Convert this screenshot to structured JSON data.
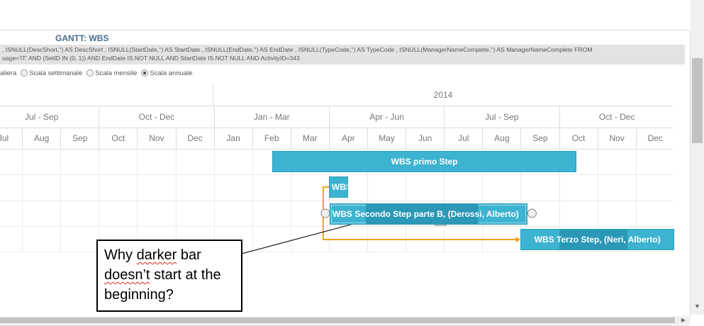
{
  "header": {
    "title": "GANTT: WBS",
    "sql_line1": ", ISNULL(DescShort,'') AS DescShort , ISNULL(StartDate,'') AS StartDate , ISNULL(EndDate,'') AS EndDate , ISNULL(TypeCode,'') AS TypeCode , ISNULL(ManagerNameComplete,'') AS ManagerNameComplete FROM",
    "sql_line2": "uage='IT' AND (SetID IN (0, 1)) AND EndDate IS NOT NULL AND StartDate IS NOT NULL AND ActivityID=343"
  },
  "scale_options": [
    {
      "label": "aliera",
      "selected": false,
      "show_radio": false
    },
    {
      "label": "Scala settimanale",
      "selected": false,
      "show_radio": true
    },
    {
      "label": "Scala mensile",
      "selected": false,
      "show_radio": true
    },
    {
      "label": "Scala annuale",
      "selected": true,
      "show_radio": true
    }
  ],
  "timeline": {
    "year_label": "2014",
    "quarters": [
      "Jul - Sep",
      "Oct - Dec",
      "Jan - Mar",
      "Apr - Jun",
      "Jul - Sep",
      "Oct - Dec"
    ],
    "months": [
      "Jul",
      "Aug",
      "Sep",
      "Oct",
      "Nov",
      "Dec",
      "Jan",
      "Feb",
      "Mar",
      "Apr",
      "May",
      "Jun",
      "Jul",
      "Aug",
      "Sep",
      "Oct",
      "Nov",
      "Dec"
    ]
  },
  "tasks": [
    {
      "label": "WBS primo Step",
      "start": "2014-03",
      "end": "2014-09",
      "progress": 0
    },
    {
      "label": "WBS",
      "start": "2014-04",
      "end": "2014-04",
      "progress": 0
    },
    {
      "label": "WBS Secondo Step parte B, (Derossi, Alberto)",
      "start": "2014-04",
      "end": "2014-08",
      "progress": 0.75,
      "selected": true
    },
    {
      "label": "WBS Terzo Step, (Neri, Alberto)",
      "start": "2014-09",
      "end": "2014-12",
      "progress": 0.7
    }
  ],
  "colors": {
    "bar": "#3cb3d0",
    "bar_progress": "#2a98b6",
    "dependency": "#f5a01a"
  },
  "callout": {
    "text": "Why darker bar doesn’t start at the beginning?"
  }
}
